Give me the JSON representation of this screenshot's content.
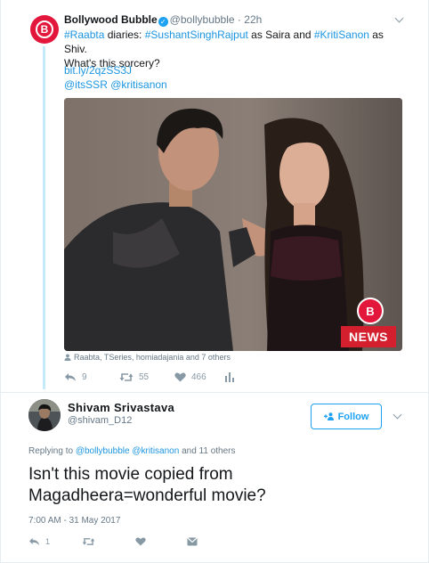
{
  "parent": {
    "name": "Bollywood Bubble",
    "handle": "@bollybubble",
    "dot": "·",
    "time": "22h",
    "avatar_letter": "B",
    "text": {
      "t1": "#Raabta",
      "t2": " diaries: ",
      "t3": "#SushantSinghRajput",
      "t4": " as Saira and ",
      "t5": "#KritiSanon",
      "t6": " as Shiv.",
      "t7": "What's this sorcery?"
    },
    "link": "bit.ly/2qzSS3J",
    "mentions": "@itsSSR @kritisanon",
    "media": {
      "logo_letter": "B",
      "news_label": "NEWS",
      "credit": "Raabta, TSeries, homiadajania and 7 others"
    },
    "actions": {
      "replies": "9",
      "retweets": "55",
      "likes": "466"
    }
  },
  "reply": {
    "name": "Shivam Srivastava",
    "handle": "@shivam_D12",
    "follow_label": "Follow",
    "replying": {
      "prefix": "Replying to ",
      "handle1": "@bollybubble",
      "handle2": "@kritisanon",
      "suffix": " and 11 others"
    },
    "text": "Isn't this movie copied from Magadheera=wonderful movie?",
    "timestamp": "7:00 AM - 31 May 2017",
    "actions": {
      "replies": "1"
    }
  },
  "colors": {
    "accent": "#1da1f2",
    "link": "#1b95e0",
    "brand_red": "#e3173b",
    "thread_line": "#c4eaf9"
  },
  "icons": [
    "verified-icon",
    "chevron-down-icon",
    "person-icon",
    "reply-icon",
    "retweet-icon",
    "heart-icon",
    "analytics-icon",
    "follow-person-icon",
    "message-icon"
  ]
}
